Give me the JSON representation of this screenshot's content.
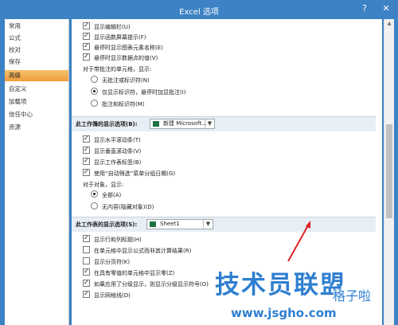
{
  "window": {
    "title": "Excel 选项",
    "help_glyph": "?",
    "close_glyph": "✕"
  },
  "nav": {
    "items": [
      "常用",
      "公式",
      "校对",
      "保存",
      "高级",
      "自定义",
      "加载项",
      "信任中心",
      "资源"
    ],
    "active_index": 4
  },
  "group_top": {
    "items": [
      {
        "label": "显示编辑栏(U)",
        "checked": true
      },
      {
        "label": "显示函数屏幕提示(F)",
        "checked": true
      },
      {
        "label": "悬停时显示图表元素名称(E)",
        "checked": true
      },
      {
        "label": "悬停时显示数据点的值(V)",
        "checked": true
      }
    ],
    "comment_heading": "对于带批注的单元格，显示:",
    "radios": [
      {
        "label": "无批注或标识符(N)",
        "selected": false
      },
      {
        "label": "仅显示标识符，悬停时加显批注(I)",
        "selected": true
      },
      {
        "label": "批注和标识符(M)",
        "selected": false
      }
    ]
  },
  "workbook_section": {
    "label": "此工作簿的显示选项(B):",
    "combo_value": "新建 Microsoft...",
    "items": [
      {
        "label": "显示水平滚动条(T)",
        "checked": true
      },
      {
        "label": "显示垂直滚动条(V)",
        "checked": true
      },
      {
        "label": "显示工作表标签(B)",
        "checked": true
      },
      {
        "label": "使用“自动筛选”菜单分组日期(G)",
        "checked": true
      }
    ],
    "objects_heading": "对于对象，显示:",
    "radios": [
      {
        "label": "全部(A)",
        "selected": true
      },
      {
        "label": "无内容(隐藏对象)(D)",
        "selected": false
      }
    ]
  },
  "worksheet_section": {
    "label": "此工作表的显示选项(S):",
    "combo_value": "Sheet1",
    "items": [
      {
        "label": "显示行和列标题(H)",
        "checked": true
      },
      {
        "label": "在单元格中显示公式而非其计算结果(R)",
        "checked": false
      },
      {
        "label": "显示分页符(K)",
        "checked": false
      },
      {
        "label": "在具有零值的单元格中显示零(Z)",
        "checked": true
      },
      {
        "label": "如果应用了分级显示，则显示分级显示符号(O)",
        "checked": true
      },
      {
        "label": "显示网格线(D)",
        "checked": true
      }
    ]
  },
  "watermark": {
    "main": "技术员联盟",
    "side": "格子啦",
    "url": "www.jsgho.com"
  },
  "colors": {
    "titlebar": "#3c82c4",
    "nav_active": "#ef9c3c",
    "section_bg": "#e8eef5",
    "watermark": "#2f7fd0",
    "arrow": "#e02020"
  }
}
